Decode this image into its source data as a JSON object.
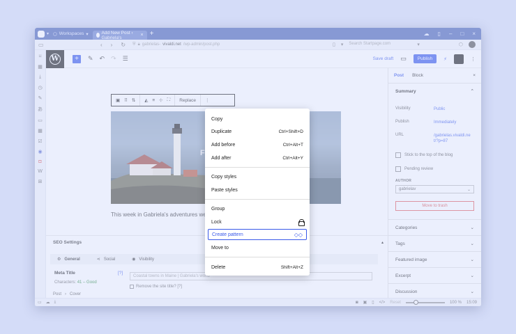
{
  "browser": {
    "workspace_label": "Workspaces",
    "tab_title": "Add New Post ‹ Gabriela's",
    "url_prefix": "gabrielas-",
    "url_domain": "vivaldi.net",
    "url_path": "/wp-admin/post.php",
    "search_placeholder": "Search Startpage.com"
  },
  "editor": {
    "save_draft": "Save draft",
    "publish": "Publish"
  },
  "block_toolbar": {
    "replace": "Replace"
  },
  "cover": {
    "overlay_text": "FAL"
  },
  "content": {
    "excerpt": "This week in Gabriela's adventures we're co"
  },
  "context_menu": {
    "items": [
      {
        "label": "Copy",
        "shortcut": ""
      },
      {
        "label": "Duplicate",
        "shortcut": "Ctrl+Shift+D"
      },
      {
        "label": "Add before",
        "shortcut": "Ctrl+Alt+T"
      },
      {
        "label": "Add after",
        "shortcut": "Ctrl+Alt+Y"
      },
      {
        "label": "Copy styles",
        "shortcut": ""
      },
      {
        "label": "Paste styles",
        "shortcut": ""
      },
      {
        "label": "Group",
        "shortcut": ""
      },
      {
        "label": "Lock",
        "shortcut": ""
      },
      {
        "label": "Create pattern",
        "shortcut": ""
      },
      {
        "label": "Move to",
        "shortcut": ""
      },
      {
        "label": "Delete",
        "shortcut": "Shift+Alt+Z"
      }
    ]
  },
  "seo": {
    "title": "SEO Settings",
    "tabs": [
      "General",
      "Social",
      "Visibility"
    ],
    "meta_title_label": "Meta Title",
    "help": "[?]",
    "characters_label": "Characters:",
    "characters_value": "41 – Good",
    "meta_title_placeholder": "Coastal towns in Maine | Gabriela's world",
    "remove_site_title": "Remove the site title? [?]"
  },
  "breadcrumb": [
    "Post",
    "Cover"
  ],
  "inspector": {
    "tabs": [
      "Post",
      "Block"
    ],
    "summary": "Summary",
    "rows": [
      {
        "key": "Visibility",
        "value": "Public"
      },
      {
        "key": "Publish",
        "value": "Immediately"
      },
      {
        "key": "URL",
        "value": "/gabrielas.vivaldi.net/?p=87"
      }
    ],
    "sticky": "Stick to the top of the blog",
    "pending": "Pending review",
    "author_label": "AUTHOR",
    "author_value": "gabrielav",
    "trash": "Move to trash",
    "panels": [
      "Categories",
      "Tags",
      "Featured image",
      "Excerpt",
      "Discussion"
    ]
  },
  "statusbar": {
    "reset": "Reset",
    "zoom": "100 %",
    "time": "15:09"
  }
}
